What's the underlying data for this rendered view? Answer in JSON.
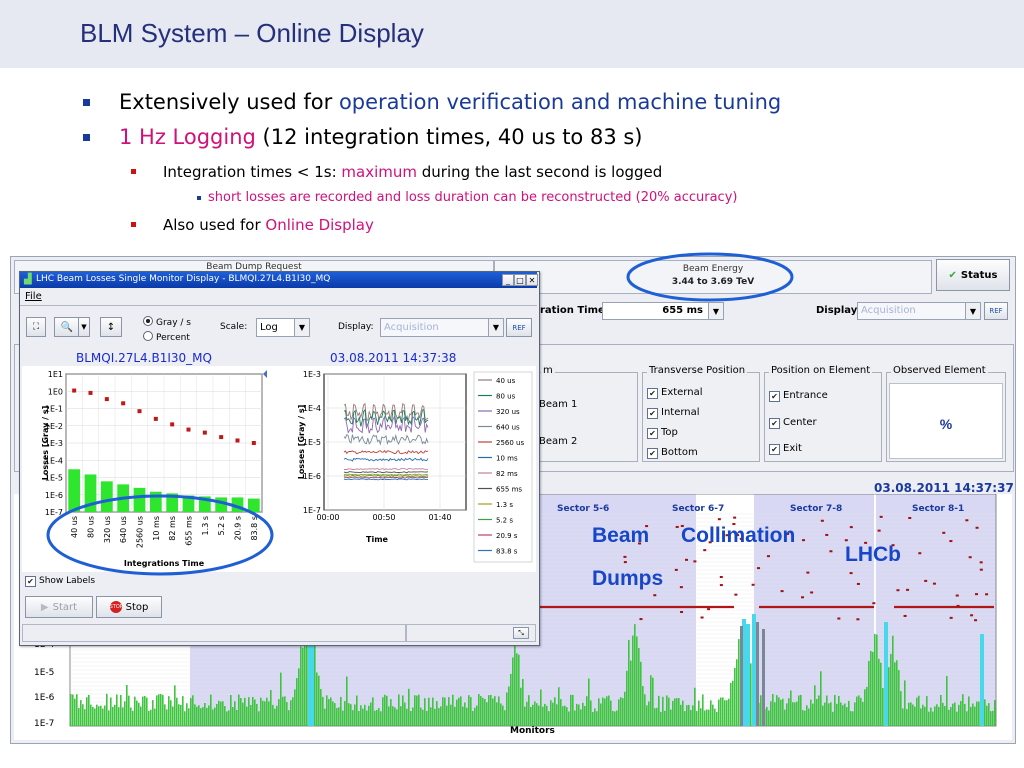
{
  "slide": {
    "title": "BLM System – Online Display",
    "bullets": [
      {
        "pre": "Extensively used for ",
        "hl": "operation verification and machine tuning",
        "post": ""
      },
      {
        "pre": "",
        "hl": "1 Hz Logging",
        "post": " (12 integration times, 40 us to 83 s)"
      }
    ],
    "sub_bullets": [
      {
        "pre": "Integration times < 1s: ",
        "hl": "maximum",
        "post": " during the last second is logged"
      },
      {
        "pre": "Also used for ",
        "hl": "Online Display",
        "post": ""
      }
    ],
    "subsub_bullet": "short losses are recorded and loss duration can be reconstructed (20% accuracy)"
  },
  "back": {
    "beam_dump_label": "Beam Dump Request",
    "beam_energy_label": "Beam Energy",
    "beam_energy_value": "3.44 to 3.69 TeV",
    "status_button": "Status",
    "integration_time_label": "ration Time:",
    "integration_time_value": "655 ms",
    "display_label": "Display:",
    "display_value": "Acquisition",
    "ref_button": "REF",
    "beam_group_label": "m",
    "beam1": "Beam 1",
    "beam2": "Beam 2",
    "transverse_group": "Transverse Position",
    "transverse_items": [
      "External",
      "Internal",
      "Top",
      "Bottom"
    ],
    "position_group": "Position on Element",
    "position_items": [
      "Entrance",
      "Center",
      "Exit"
    ],
    "observed_group": "Observed Element",
    "observed_value": "%",
    "timestamp": "03.08.2011 14:37:37",
    "sectors": [
      "Sector 5-6",
      "Sector 6-7",
      "Sector 7-8",
      "Sector 8-1"
    ],
    "y_ticks": [
      "1E-4",
      "1E-5",
      "1E-6",
      "1E-7"
    ],
    "x_label": "Monitors"
  },
  "annotations": {
    "beam_dumps_1": "Beam",
    "beam_dumps_2": "Dumps",
    "collimation": "Collimation",
    "lhcb": "LHCb"
  },
  "popup": {
    "title": "LHC Beam Losses Single Monitor Display - BLMQI.27L4.B1I30_MQ",
    "menu_file": "File",
    "radio_gray": "Gray / s",
    "radio_percent": "Percent",
    "scale_label": "Scale:",
    "scale_value": "Log",
    "display_label": "Display:",
    "display_value": "Acquisition",
    "ref_button": "REF",
    "monitor_name": "BLMQI.27L4.B1I30_MQ",
    "timestamp": "03.08.2011 14:37:38",
    "show_labels": "Show Labels",
    "start_button": "Start",
    "stop_button": "Stop"
  },
  "colors": {
    "title_blue": "#24307a",
    "highlight_blue": "#1a3a9a",
    "highlight_magenta": "#d1107a",
    "bar_green": "#2ee62e",
    "max_red": "#c01818",
    "ellipse_blue": "#1f5fd6",
    "annotation_blue": "#1846c8"
  },
  "chart_data": [
    {
      "type": "bar",
      "ylabel": "Losses [Gray / s]",
      "xlabel": "Integrations Time",
      "y_scale": "log",
      "ylim": [
        1e-07,
        10
      ],
      "y_ticks": [
        "1E1",
        "1E0",
        "1E-1",
        "1E-2",
        "1E-3",
        "1E-4",
        "1E-5",
        "1E-6",
        "1E-7"
      ],
      "categories": [
        "40 us",
        "80 us",
        "320 us",
        "640 us",
        "2560 us",
        "10 ms",
        "82 ms",
        "655 ms",
        "1.3 s",
        "5.2 s",
        "20.9 s",
        "83.8 s"
      ],
      "values": [
        3e-05,
        1.5e-05,
        6e-06,
        4e-06,
        2.5e-06,
        1.5e-06,
        1.2e-06,
        9e-07,
        8e-07,
        7e-07,
        7e-07,
        6e-07
      ],
      "max_values": [
        1.1,
        0.8,
        0.35,
        0.2,
        0.07,
        0.025,
        0.012,
        0.006,
        0.004,
        0.0022,
        0.0014,
        0.001
      ],
      "grid": true
    },
    {
      "type": "line",
      "ylabel": "Losses [Gray / s]",
      "xlabel": "Time",
      "y_scale": "log",
      "ylim": [
        1e-07,
        0.001
      ],
      "y_ticks": [
        "1E-3",
        "1E-4",
        "1E-5",
        "1E-6",
        "1E-7"
      ],
      "x_ticks": [
        "00:00",
        "00:50",
        "01:40"
      ],
      "legend_position": "right",
      "series": [
        {
          "name": "40 us",
          "color": "#9a7a7a",
          "level": 6e-05
        },
        {
          "name": "80 us",
          "color": "#1f7a5a",
          "level": 4e-05
        },
        {
          "name": "320 us",
          "color": "#8a6ab0",
          "level": 2.5e-05
        },
        {
          "name": "640 us",
          "color": "#7a8a9a",
          "level": 1.2e-05
        },
        {
          "name": "2560 us",
          "color": "#c04040",
          "level": 5e-06
        },
        {
          "name": "10 ms",
          "color": "#2a6ab0",
          "level": 3e-06
        },
        {
          "name": "82 ms",
          "color": "#c080a0",
          "level": 1.6e-06
        },
        {
          "name": "655 ms",
          "color": "#505050",
          "level": 1.3e-06
        },
        {
          "name": "1.3 s",
          "color": "#a0a020",
          "level": 1.1e-06
        },
        {
          "name": "5.2 s",
          "color": "#40a040",
          "level": 1e-06
        },
        {
          "name": "20.9 s",
          "color": "#c04060",
          "level": 9e-07
        },
        {
          "name": "83.8 s",
          "color": "#3070c0",
          "level": 8e-07
        }
      ]
    }
  ]
}
